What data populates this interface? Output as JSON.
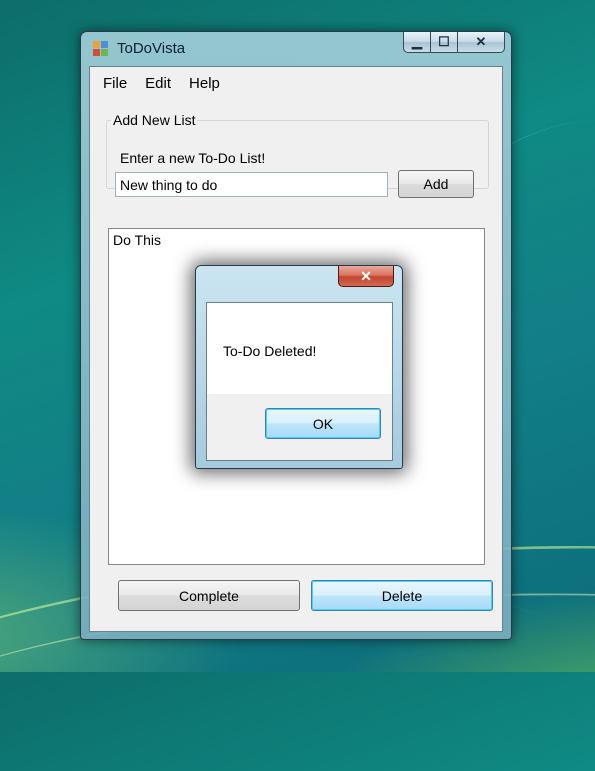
{
  "window": {
    "title": "ToDoVista",
    "caption_minimize": "▁",
    "caption_maximize": "☐",
    "caption_close": "✕"
  },
  "menu": {
    "items": [
      {
        "label": "File"
      },
      {
        "label": "Edit"
      },
      {
        "label": "Help"
      }
    ]
  },
  "add_group": {
    "legend": "Add New List",
    "prompt": "Enter a new To-Do List!",
    "input_value": "New thing to do",
    "add_label": "Add"
  },
  "todo_list": {
    "items": [
      "Do This"
    ]
  },
  "actions": {
    "complete_label": "Complete",
    "delete_label": "Delete"
  },
  "dialog": {
    "message": "To-Do Deleted!",
    "ok_label": "OK",
    "close_glyph": "✕"
  },
  "colors": {
    "focus_button_accent": "#3c7fb1",
    "close_button_red": "#c2452f"
  }
}
